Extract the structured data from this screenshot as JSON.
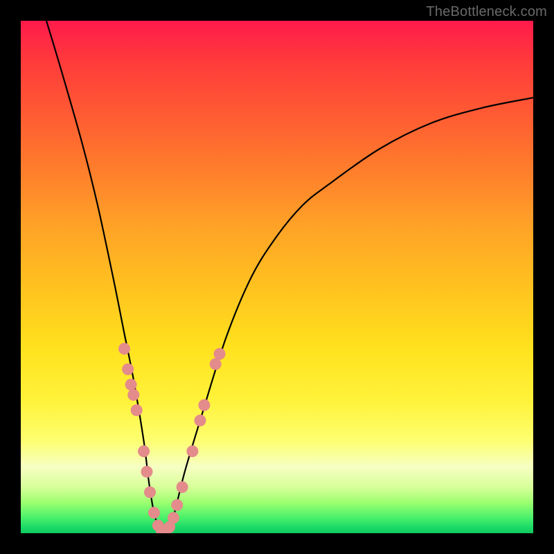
{
  "attribution": "TheBottleneck.com",
  "colors": {
    "frame": "#000000",
    "curve": "#000000",
    "marker_fill": "#e48b8b",
    "marker_stroke": "#d07676",
    "gradient_top": "#ff1a4c",
    "gradient_bottom": "#10c85e"
  },
  "chart_data": {
    "type": "line",
    "title": "",
    "xlabel": "",
    "ylabel": "",
    "xlim": [
      0,
      100
    ],
    "ylim": [
      0,
      100
    ],
    "grid": false,
    "legend": false,
    "series": [
      {
        "name": "bottleneck-curve",
        "x": [
          5,
          8,
          12,
          15,
          18,
          20,
          22,
          24,
          25,
          26,
          27,
          28,
          29,
          30,
          32,
          35,
          40,
          45,
          50,
          55,
          60,
          70,
          80,
          90,
          100
        ],
        "y": [
          100,
          90,
          76,
          64,
          50,
          40,
          30,
          18,
          10,
          4,
          1,
          0,
          1,
          4,
          12,
          22,
          38,
          50,
          58,
          64,
          68,
          75,
          80,
          83,
          85
        ]
      }
    ],
    "markers": {
      "name": "highlighted-points",
      "points": [
        {
          "x": 20.2,
          "y": 36
        },
        {
          "x": 20.9,
          "y": 32
        },
        {
          "x": 21.5,
          "y": 29
        },
        {
          "x": 22.0,
          "y": 27
        },
        {
          "x": 22.6,
          "y": 24
        },
        {
          "x": 24.0,
          "y": 16
        },
        {
          "x": 24.6,
          "y": 12
        },
        {
          "x": 25.2,
          "y": 8
        },
        {
          "x": 26.0,
          "y": 4
        },
        {
          "x": 26.8,
          "y": 1.5
        },
        {
          "x": 27.5,
          "y": 0.5
        },
        {
          "x": 28.3,
          "y": 0.5
        },
        {
          "x": 29.0,
          "y": 1.2
        },
        {
          "x": 29.8,
          "y": 3
        },
        {
          "x": 30.5,
          "y": 5.5
        },
        {
          "x": 31.5,
          "y": 9
        },
        {
          "x": 33.5,
          "y": 16
        },
        {
          "x": 35.0,
          "y": 22
        },
        {
          "x": 35.8,
          "y": 25
        },
        {
          "x": 38.0,
          "y": 33
        },
        {
          "x": 38.8,
          "y": 35
        }
      ]
    }
  }
}
